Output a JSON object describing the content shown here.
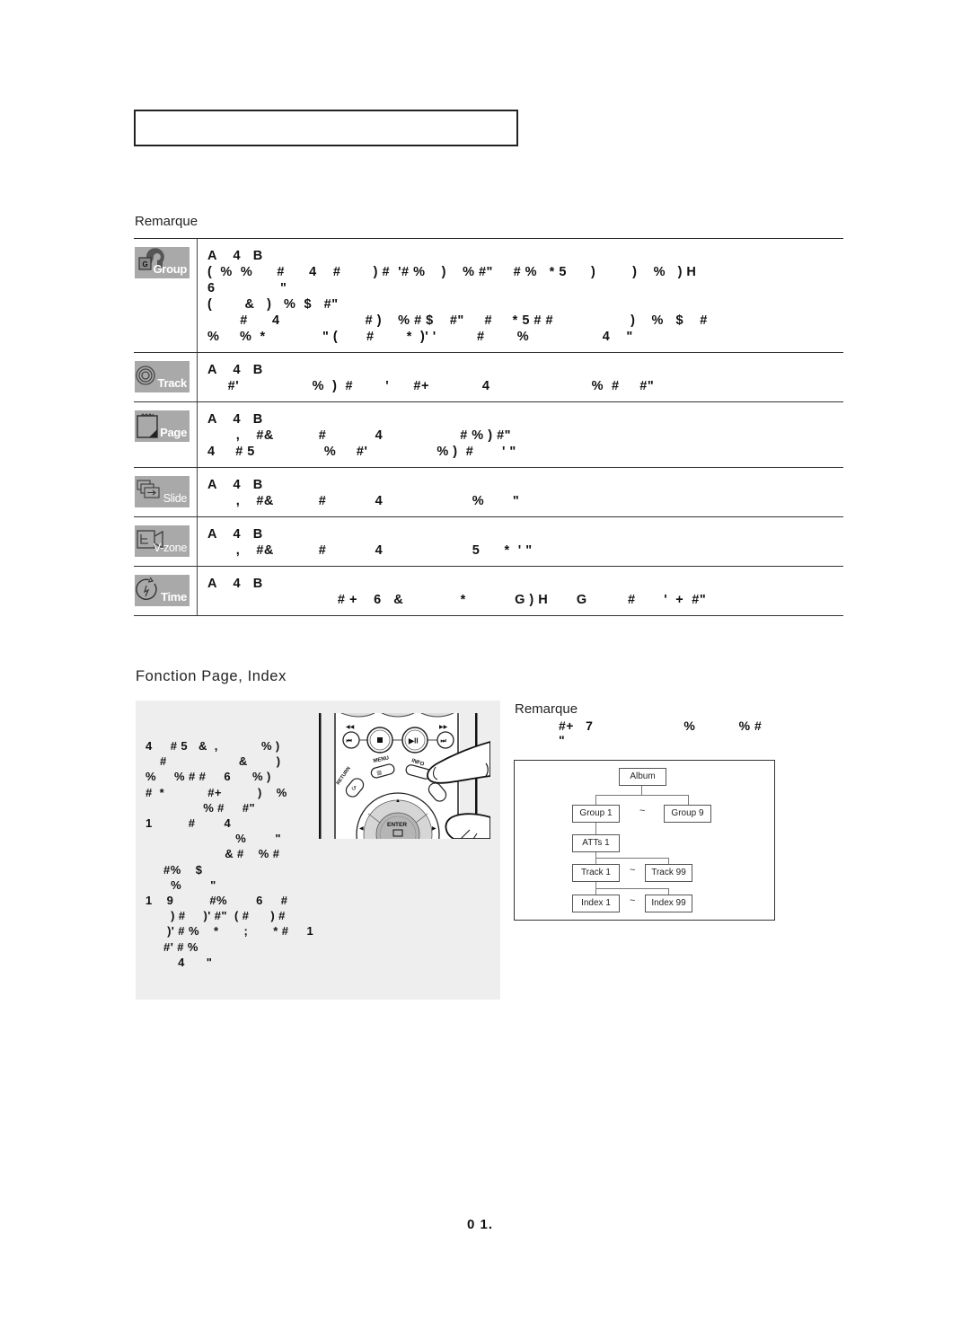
{
  "page": {
    "title_box_text": "",
    "page_number": "0 1."
  },
  "top_section": {
    "remarque_label": "Remarque",
    "rows": [
      {
        "icon": "group-icon",
        "icon_label": "Group",
        "lines": [
          "A    4   B",
          "(  %  %      #      4    #        ) #  '# %    )    % #\"     # %   * 5      )         )    %   ) H",
          "6                \"",
          "(        &   )   %  $   #\"",
          "        #      4                     # )    % # $    #\"     #     * 5 # #                   )    %   $    #",
          "%     %  *              \" (       #        *  )' '          #        %                  4    \""
        ]
      },
      {
        "icon": "track-icon",
        "icon_label": "Track",
        "lines": [
          "A    4   B",
          "     #'                  %  )  #        '      #+             4                         %  #     #\""
        ]
      },
      {
        "icon": "page-icon",
        "icon_label": "Page",
        "lines": [
          "A    4   B",
          "       ,    #&           #            4                   # % ) #\"",
          "4     # 5                 %     #'                 % )  #       ' \""
        ]
      },
      {
        "icon": "slide-icon",
        "icon_label": "Slide",
        "lines": [
          "A    4   B",
          "       ,    #&           #            4                      %       \""
        ]
      },
      {
        "icon": "vzone-icon",
        "icon_label": "V-zone",
        "lines": [
          "A    4   B",
          "       ,    #&           #            4                      5      *  ' \""
        ]
      },
      {
        "icon": "time-icon",
        "icon_label": "Time",
        "lines": [
          "A    4   B",
          "                                # +    6   &              *            G ) H       G          #       '  +  #\""
        ]
      }
    ]
  },
  "index_section": {
    "title": "Fonction Page, Index",
    "panel_lines": [
      "4     # 5   &  ,            % )",
      "    #                    &        )",
      "%     % # #     6      % )",
      "#  *            #+          )    %",
      "                % #     #\"",
      "1          #        4",
      "                         %        \"",
      "                      & #    % #",
      "     #%    $",
      "       %        \"",
      "1    9          #%        6     #",
      "       ) #     )' #\"  ( #      ) #",
      "      )' # %    *       ;       * #     1",
      "     #' # %",
      "         4      \""
    ],
    "remote_buttons": {
      "menu": "MENU",
      "info": "INFO",
      "return": "RETURN",
      "enter": "ENTER"
    },
    "note": {
      "label": "Remarque",
      "lines": [
        "#+   7                       %           % #",
        "\""
      ]
    },
    "tree": {
      "root": "Album",
      "groups": [
        "Group 1",
        "Group 9"
      ],
      "atts": "ATTs 1",
      "tracks": [
        "Track 1",
        "Track 99"
      ],
      "indexes": [
        "Index 1",
        "Index 99"
      ],
      "range_symbol": "~"
    }
  }
}
